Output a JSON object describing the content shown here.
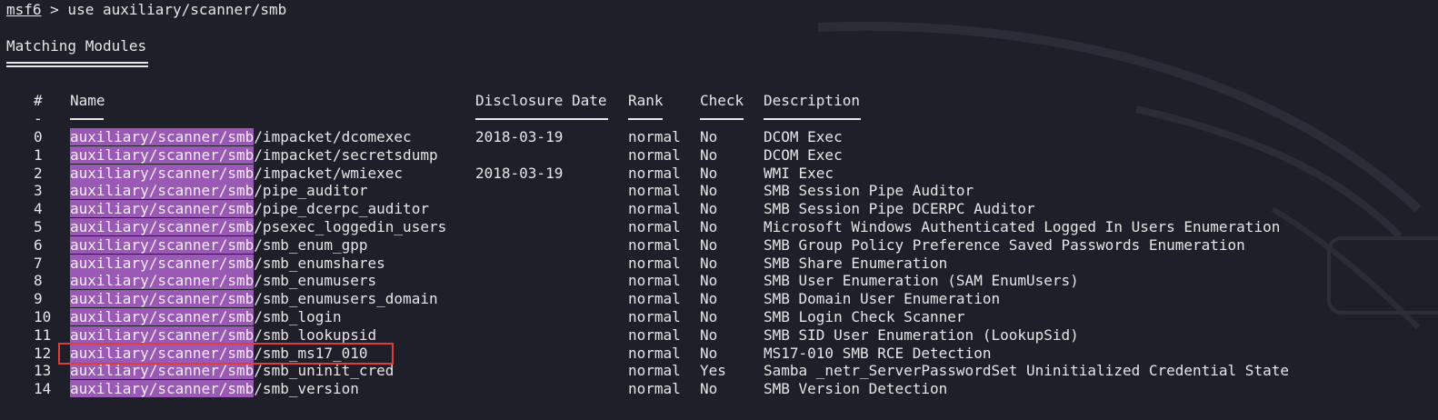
{
  "terminal": {
    "prompt_name": "msf6",
    "prompt_rest": " > use auxiliary/scanner/smb",
    "section_title": "Matching Modules",
    "columns": {
      "num": "#",
      "name": "Name",
      "date": "Disclosure Date",
      "rank": "Rank",
      "check": "Check",
      "desc": "Description"
    },
    "name_rule": "-",
    "highlight_prefix": "auxiliary/scanner/smb",
    "rows": [
      {
        "num": "0",
        "suffix": "/impacket/dcomexec",
        "date": "2018-03-19",
        "rank": "normal",
        "check": "No",
        "desc": "DCOM Exec"
      },
      {
        "num": "1",
        "suffix": "/impacket/secretsdump",
        "date": "",
        "rank": "normal",
        "check": "No",
        "desc": "DCOM Exec"
      },
      {
        "num": "2",
        "suffix": "/impacket/wmiexec",
        "date": "2018-03-19",
        "rank": "normal",
        "check": "No",
        "desc": "WMI Exec"
      },
      {
        "num": "3",
        "suffix": "/pipe_auditor",
        "date": "",
        "rank": "normal",
        "check": "No",
        "desc": "SMB Session Pipe Auditor"
      },
      {
        "num": "4",
        "suffix": "/pipe_dcerpc_auditor",
        "date": "",
        "rank": "normal",
        "check": "No",
        "desc": "SMB Session Pipe DCERPC Auditor"
      },
      {
        "num": "5",
        "suffix": "/psexec_loggedin_users",
        "date": "",
        "rank": "normal",
        "check": "No",
        "desc": "Microsoft Windows Authenticated Logged In Users Enumeration"
      },
      {
        "num": "6",
        "suffix": "/smb_enum_gpp",
        "date": "",
        "rank": "normal",
        "check": "No",
        "desc": "SMB Group Policy Preference Saved Passwords Enumeration"
      },
      {
        "num": "7",
        "suffix": "/smb_enumshares",
        "date": "",
        "rank": "normal",
        "check": "No",
        "desc": "SMB Share Enumeration"
      },
      {
        "num": "8",
        "suffix": "/smb_enumusers",
        "date": "",
        "rank": "normal",
        "check": "No",
        "desc": "SMB User Enumeration (SAM EnumUsers)"
      },
      {
        "num": "9",
        "suffix": "/smb_enumusers_domain",
        "date": "",
        "rank": "normal",
        "check": "No",
        "desc": "SMB Domain User Enumeration"
      },
      {
        "num": "10",
        "suffix": "/smb_login",
        "date": "",
        "rank": "normal",
        "check": "No",
        "desc": "SMB Login Check Scanner"
      },
      {
        "num": "11",
        "suffix": "/smb_lookupsid",
        "date": "",
        "rank": "normal",
        "check": "No",
        "desc": "SMB SID User Enumeration (LookupSid)"
      },
      {
        "num": "12",
        "suffix": "/smb_ms17_010",
        "date": "",
        "rank": "normal",
        "check": "No",
        "desc": "MS17-010 SMB RCE Detection"
      },
      {
        "num": "13",
        "suffix": "/smb_uninit_cred",
        "date": "",
        "rank": "normal",
        "check": "Yes",
        "desc": "Samba _netr_ServerPasswordSet Uninitialized Credential State"
      },
      {
        "num": "14",
        "suffix": "/smb_version",
        "date": "",
        "rank": "normal",
        "check": "No",
        "desc": "SMB Version Detection"
      }
    ]
  },
  "colors": {
    "background": "#1e1f29",
    "text": "#e6e6e6",
    "highlight": "#9b59b6",
    "annotation_box": "#e03c3c"
  }
}
